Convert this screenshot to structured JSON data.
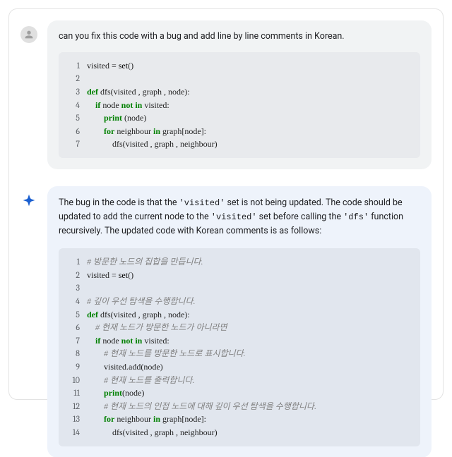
{
  "user": {
    "prompt": "can you fix this code with a bug and add line by line comments in Korean.",
    "code": [
      {
        "n": 1,
        "tokens": [
          [
            "",
            "visited = "
          ],
          [
            "fn",
            "set"
          ],
          [
            "",
            "()"
          ]
        ]
      },
      {
        "n": 2,
        "tokens": [
          [
            "",
            ""
          ]
        ]
      },
      {
        "n": 3,
        "tokens": [
          [
            "kw",
            "def"
          ],
          [
            "",
            " dfs(visited , graph , node):"
          ]
        ]
      },
      {
        "n": 4,
        "tokens": [
          [
            "",
            "    "
          ],
          [
            "kw",
            "if"
          ],
          [
            "",
            " node "
          ],
          [
            "kw",
            "not in"
          ],
          [
            "",
            " visited:"
          ]
        ]
      },
      {
        "n": 5,
        "tokens": [
          [
            "",
            "        "
          ],
          [
            "kw",
            "print"
          ],
          [
            "",
            " (node)"
          ]
        ]
      },
      {
        "n": 6,
        "tokens": [
          [
            "",
            "        "
          ],
          [
            "kw",
            "for"
          ],
          [
            "",
            " neighbour "
          ],
          [
            "kw",
            "in"
          ],
          [
            "",
            " graph[node]:"
          ]
        ]
      },
      {
        "n": 7,
        "tokens": [
          [
            "",
            "            dfs(visited , graph , neighbour)"
          ]
        ]
      }
    ]
  },
  "ai": {
    "resp_a": "The bug in the code is that the ",
    "resp_b": "'visited'",
    "resp_c": " set is not being updated. The code should be updated to add the current node to the ",
    "resp_d": "'visited'",
    "resp_e": " set before calling the ",
    "resp_f": "'dfs'",
    "resp_g": " function recursively. The updated code with Korean comments is as follows:",
    "code": [
      {
        "n": 1,
        "tokens": [
          [
            "cmt",
            "# 방문한 노드의 집합을 만듭니다."
          ]
        ]
      },
      {
        "n": 2,
        "tokens": [
          [
            "",
            "visited = "
          ],
          [
            "fn",
            "set"
          ],
          [
            "",
            "()"
          ]
        ]
      },
      {
        "n": 3,
        "tokens": [
          [
            "",
            ""
          ]
        ]
      },
      {
        "n": 4,
        "tokens": [
          [
            "cmt",
            "# 깊이 우선 탐색을 수행합니다."
          ]
        ]
      },
      {
        "n": 5,
        "tokens": [
          [
            "kw",
            "def"
          ],
          [
            "",
            " dfs(visited , graph , node):"
          ]
        ]
      },
      {
        "n": 6,
        "tokens": [
          [
            "",
            "    "
          ],
          [
            "cmt",
            "# 현재 노드가 방문한 노드가 아니라면"
          ]
        ]
      },
      {
        "n": 7,
        "tokens": [
          [
            "",
            "    "
          ],
          [
            "kw",
            "if"
          ],
          [
            "",
            " node "
          ],
          [
            "kw",
            "not in"
          ],
          [
            "",
            " visited:"
          ]
        ]
      },
      {
        "n": 8,
        "tokens": [
          [
            "",
            "        "
          ],
          [
            "cmt",
            "# 현재 노드를 방문한 노드로 표시합니다."
          ]
        ]
      },
      {
        "n": 9,
        "tokens": [
          [
            "",
            "        visited.add(node)"
          ]
        ]
      },
      {
        "n": 10,
        "tokens": [
          [
            "",
            "        "
          ],
          [
            "cmt",
            "# 현재 노드를 출력합니다."
          ]
        ]
      },
      {
        "n": 11,
        "tokens": [
          [
            "",
            "        "
          ],
          [
            "kw",
            "print"
          ],
          [
            "",
            "(node)"
          ]
        ]
      },
      {
        "n": 12,
        "tokens": [
          [
            "",
            "        "
          ],
          [
            "cmt",
            "# 현재 노드의 인접 노드에 대해 깊이 우선 탐색을 수행합니다."
          ]
        ]
      },
      {
        "n": 13,
        "tokens": [
          [
            "",
            "        "
          ],
          [
            "kw",
            "for"
          ],
          [
            "",
            " neighbour "
          ],
          [
            "kw",
            "in"
          ],
          [
            "",
            " graph[node]:"
          ]
        ]
      },
      {
        "n": 14,
        "tokens": [
          [
            "",
            "            dfs(visited , graph , neighbour)"
          ]
        ]
      }
    ]
  }
}
